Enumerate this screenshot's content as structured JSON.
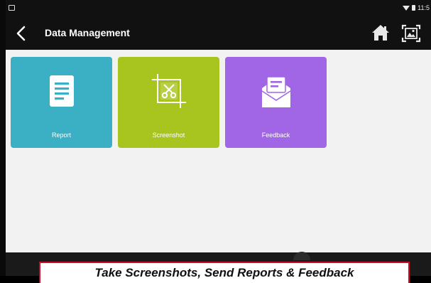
{
  "status_bar": {
    "time": "11:5"
  },
  "app_bar": {
    "title": "Data Management"
  },
  "tiles": [
    {
      "label": "Report",
      "color": "#3bafc4",
      "icon": "document-icon"
    },
    {
      "label": "Screenshot",
      "color": "#a8c41e",
      "icon": "crop-scissors-icon"
    },
    {
      "label": "Feedback",
      "color": "#a166e6",
      "icon": "envelope-message-icon"
    }
  ],
  "caption": {
    "text": "Take Screenshots, Send Reports & Feedback"
  },
  "colors": {
    "app_bar": "#111111",
    "background": "#f2f2f2",
    "caption_border": "#c8102e"
  }
}
